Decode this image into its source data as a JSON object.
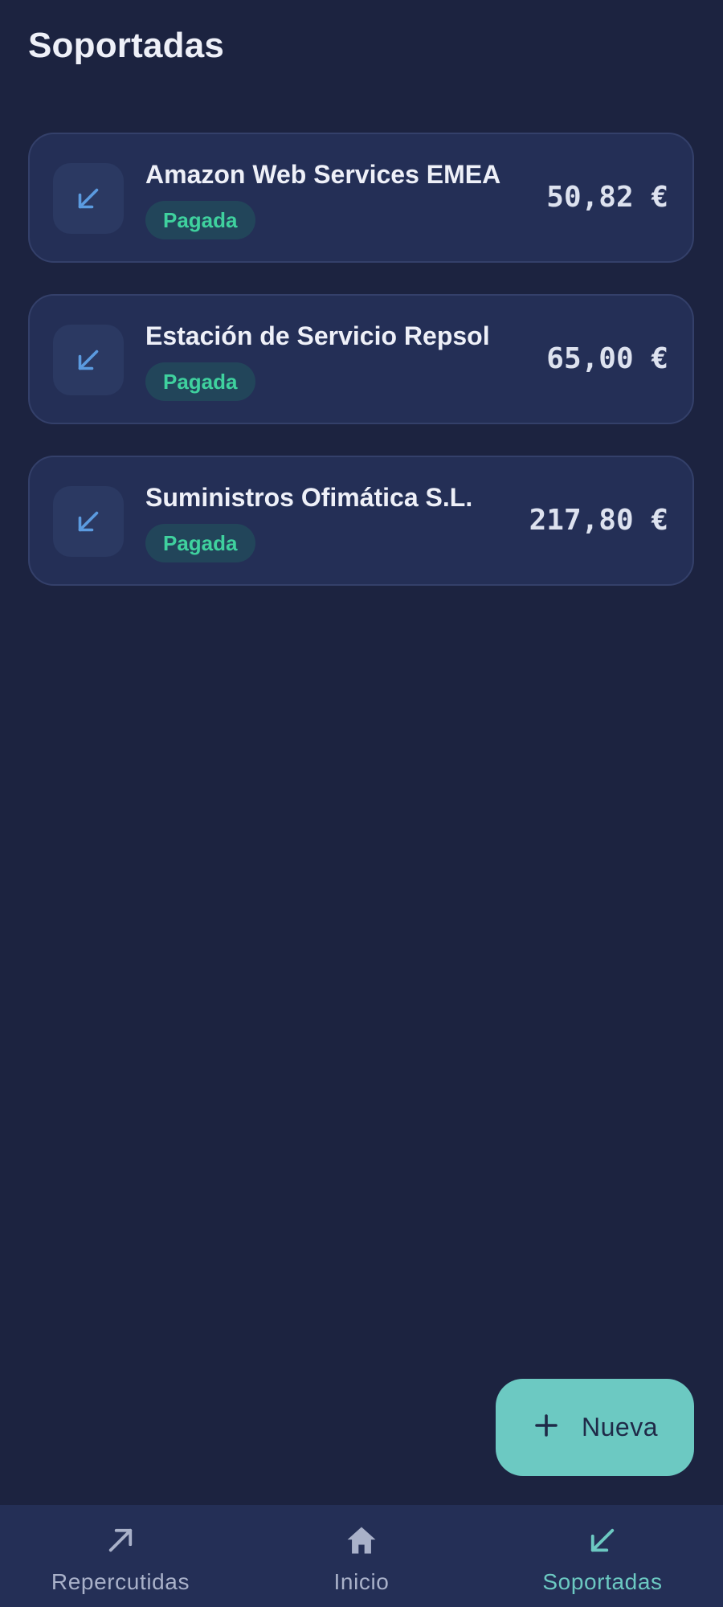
{
  "header": {
    "title": "Soportadas"
  },
  "invoices": [
    {
      "name": "Amazon Web Services EMEA",
      "status": "Pagada",
      "amount": "50,82 €",
      "icon": "arrow-down-left-icon"
    },
    {
      "name": "Estación de Servicio Repsol",
      "status": "Pagada",
      "amount": "65,00 €",
      "icon": "arrow-down-left-icon"
    },
    {
      "name": "Suministros Ofimática S.L.",
      "status": "Pagada",
      "amount": "217,80 €",
      "icon": "arrow-down-left-icon"
    }
  ],
  "fab": {
    "label": "Nueva",
    "icon": "plus-icon"
  },
  "nav": {
    "items": [
      {
        "label": "Repercutidas",
        "icon": "arrow-up-right-icon",
        "active": false
      },
      {
        "label": "Inicio",
        "icon": "home-icon",
        "active": false
      },
      {
        "label": "Soportadas",
        "icon": "arrow-down-left-icon",
        "active": true
      }
    ]
  },
  "colors": {
    "background": "#1c2340",
    "card": "#242f56",
    "accent": "#6cc9c2",
    "status_paid": "#3fd19e",
    "icon_blue": "#5b9be0"
  }
}
